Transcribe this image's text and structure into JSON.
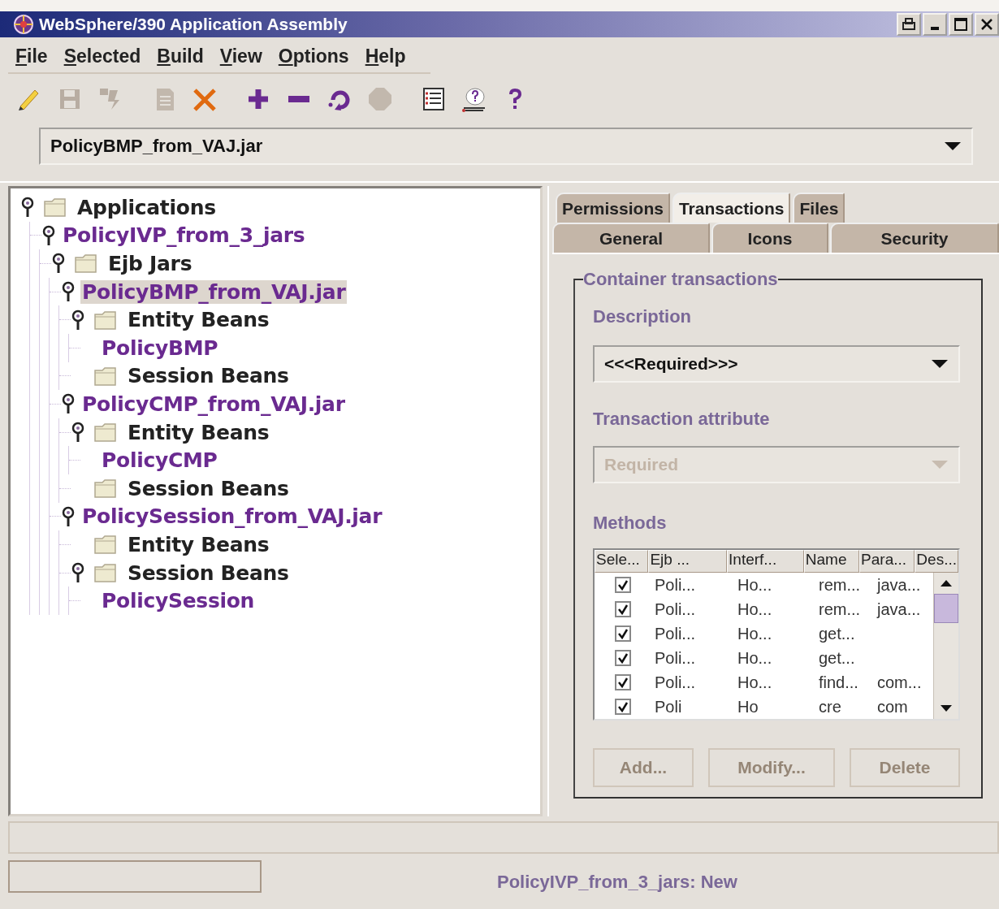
{
  "window": {
    "title": "WebSphere/390 Application Assembly"
  },
  "menu": [
    "File",
    "Selected",
    "Build",
    "View",
    "Options",
    "Help"
  ],
  "toolbar": [
    [
      {
        "kind": "pencil",
        "disabled": false
      },
      {
        "kind": "save",
        "disabled": true
      },
      {
        "kind": "move",
        "disabled": true
      }
    ],
    [
      {
        "kind": "document",
        "disabled": true
      },
      {
        "kind": "delete",
        "disabled": false
      }
    ],
    [
      {
        "kind": "add",
        "disabled": false
      },
      {
        "kind": "remove",
        "disabled": false
      },
      {
        "kind": "refresh",
        "disabled": false
      },
      {
        "kind": "stop",
        "disabled": true
      }
    ],
    [
      {
        "kind": "list",
        "disabled": false
      },
      {
        "kind": "help-person",
        "disabled": false
      },
      {
        "kind": "help",
        "disabled": false
      }
    ]
  ],
  "jar_selector": {
    "value": "PolicyBMP_from_VAJ.jar"
  },
  "tree": [
    {
      "label": "Applications",
      "kind": "folder",
      "expanded": true,
      "selected": false,
      "children": [
        {
          "label": "PolicyIVP_from_3_jars",
          "kind": "item",
          "expanded": true,
          "selected": false,
          "children": [
            {
              "label": "Ejb Jars",
              "kind": "folder",
              "expanded": true,
              "selected": false,
              "children": [
                {
                  "label": "PolicyBMP_from_VAJ.jar",
                  "kind": "item",
                  "expanded": true,
                  "selected": true,
                  "children": [
                    {
                      "label": "Entity Beans",
                      "kind": "folder",
                      "expanded": true,
                      "selected": false,
                      "children": [
                        {
                          "label": "PolicyBMP",
                          "kind": "item",
                          "expanded": false,
                          "selected": false
                        }
                      ]
                    },
                    {
                      "label": "Session Beans",
                      "kind": "folder",
                      "expanded": false,
                      "selected": false
                    }
                  ]
                },
                {
                  "label": "PolicyCMP_from_VAJ.jar",
                  "kind": "item",
                  "expanded": true,
                  "selected": false,
                  "children": [
                    {
                      "label": "Entity Beans",
                      "kind": "folder",
                      "expanded": true,
                      "selected": false,
                      "children": [
                        {
                          "label": "PolicyCMP",
                          "kind": "item",
                          "expanded": false,
                          "selected": false
                        }
                      ]
                    },
                    {
                      "label": "Session Beans",
                      "kind": "folder",
                      "expanded": false,
                      "selected": false
                    }
                  ]
                },
                {
                  "label": "PolicySession_from_VAJ.jar",
                  "kind": "item",
                  "expanded": true,
                  "selected": false,
                  "children": [
                    {
                      "label": "Entity Beans",
                      "kind": "folder",
                      "expanded": false,
                      "selected": false
                    },
                    {
                      "label": "Session Beans",
                      "kind": "folder",
                      "expanded": true,
                      "selected": false,
                      "children": [
                        {
                          "label": "PolicySession",
                          "kind": "item",
                          "expanded": false,
                          "selected": false
                        }
                      ]
                    }
                  ]
                }
              ]
            }
          ]
        }
      ]
    }
  ],
  "tab_rows": [
    [
      {
        "label": "Permissions",
        "selected": false
      },
      {
        "label": "Transactions",
        "selected": true
      },
      {
        "label": "Files",
        "selected": false
      }
    ],
    [
      {
        "label": "General",
        "selected": false
      },
      {
        "label": "Icons",
        "selected": false
      },
      {
        "label": "Security",
        "selected": false
      }
    ]
  ],
  "transactions": {
    "group_title": "Container transactions",
    "description_label": "Description",
    "description_value": "<<<Required>>>",
    "attribute_label": "Transaction attribute",
    "attribute_value": "Required",
    "attribute_disabled": true,
    "methods_label": "Methods",
    "select_column": "Sele...",
    "columns": [
      "Ejb ...",
      "Interf...",
      "Name",
      "Para...",
      "Des..."
    ],
    "rows": [
      {
        "checked": true,
        "cells": [
          "Poli...",
          "Ho...",
          "rem...",
          "java..."
        ]
      },
      {
        "checked": true,
        "cells": [
          "Poli...",
          "Ho...",
          "rem...",
          "java..."
        ]
      },
      {
        "checked": true,
        "cells": [
          "Poli...",
          "Ho...",
          "get..."
        ]
      },
      {
        "checked": true,
        "cells": [
          "Poli...",
          "Ho...",
          "get..."
        ]
      },
      {
        "checked": true,
        "cells": [
          "Poli...",
          "Ho...",
          "find...",
          "com..."
        ]
      },
      {
        "checked": true,
        "cells": [
          "Poli",
          "Ho",
          "cre",
          "com"
        ]
      }
    ],
    "buttons": [
      {
        "label": "Add...",
        "disabled": true
      },
      {
        "label": "Modify...",
        "disabled": true
      },
      {
        "label": "Delete",
        "disabled": true
      }
    ]
  },
  "status_bar": {
    "message": "PolicyIVP_from_3_jars: New"
  }
}
